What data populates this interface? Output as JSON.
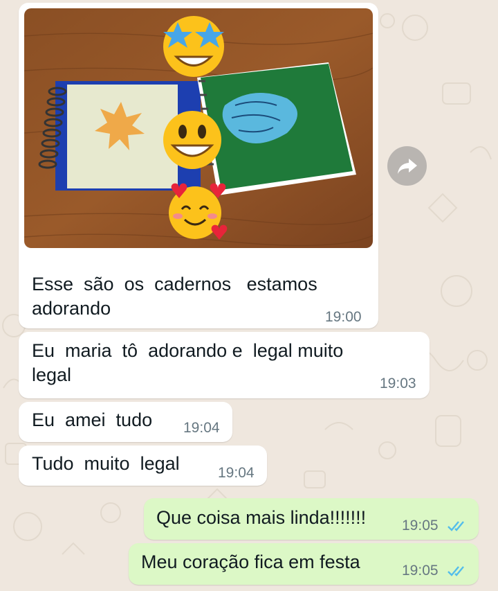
{
  "chat": {
    "messages": [
      {
        "direction": "incoming",
        "has_photo": true,
        "photo_description": "two painted spiral notebooks on a wooden table with star-eyes, grinning and smiling-hearts emoji overlays",
        "text": "Esse  são  os  cadernos   estamos\nadorando",
        "time": "19:00"
      },
      {
        "direction": "incoming",
        "text": "Eu  maria  tô  adorando e  legal muito\nlegal",
        "time": "19:03"
      },
      {
        "direction": "incoming",
        "text": "Eu  amei  tudo",
        "time": "19:04"
      },
      {
        "direction": "incoming",
        "text": "Tudo  muito  legal",
        "time": "19:04"
      },
      {
        "direction": "outgoing",
        "text": "Que coisa mais linda!!!!!!!",
        "time": "19:05",
        "status": "read"
      },
      {
        "direction": "outgoing",
        "text": "Meu coração fica em festa",
        "time": "19:05",
        "status": "read"
      }
    ],
    "forward_icon": "forward-arrow-icon",
    "status_icon": "double-check-icon",
    "colors": {
      "wallpaper": "#efe7de",
      "incoming_bubble": "#ffffff",
      "outgoing_bubble": "#dcf8c6",
      "timestamp": "#667781",
      "read_ticks": "#53bdeb"
    }
  }
}
